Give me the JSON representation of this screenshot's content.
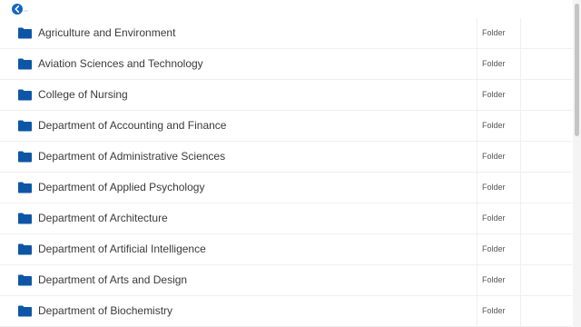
{
  "colors": {
    "accent": "#1565c0",
    "folder_icon": "#0d56a6",
    "text": "#3a3a3a",
    "divider": "#efefef"
  },
  "toolbar": {
    "back_icon": "chevron-left-circle-icon"
  },
  "files": [
    {
      "name": "Agriculture and Environment",
      "type": "Folder",
      "icon": "folder-icon"
    },
    {
      "name": "Aviation Sciences and Technology",
      "type": "Folder",
      "icon": "folder-icon"
    },
    {
      "name": "College of Nursing",
      "type": "Folder",
      "icon": "folder-icon"
    },
    {
      "name": "Department of Accounting and Finance",
      "type": "Folder",
      "icon": "folder-icon"
    },
    {
      "name": "Department of Administrative Sciences",
      "type": "Folder",
      "icon": "folder-icon"
    },
    {
      "name": "Department of Applied Psychology",
      "type": "Folder",
      "icon": "folder-icon"
    },
    {
      "name": "Department of Architecture",
      "type": "Folder",
      "icon": "folder-icon"
    },
    {
      "name": "Department of Artificial Intelligence",
      "type": "Folder",
      "icon": "folder-icon"
    },
    {
      "name": "Department of Arts and Design",
      "type": "Folder",
      "icon": "folder-icon"
    },
    {
      "name": "Department of Biochemistry",
      "type": "Folder",
      "icon": "folder-icon"
    }
  ]
}
